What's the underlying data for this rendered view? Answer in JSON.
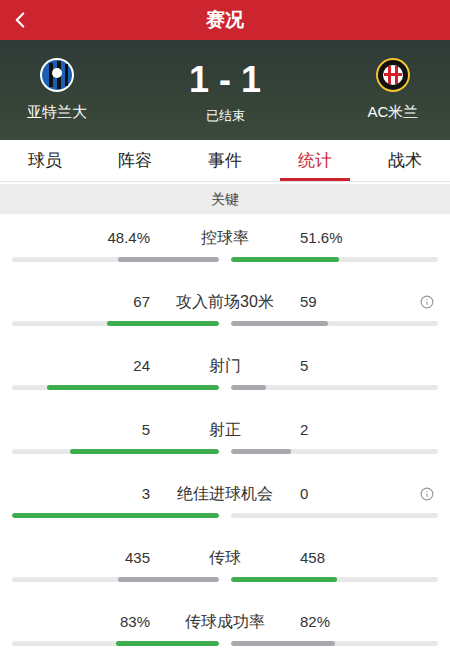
{
  "header": {
    "title": "赛况"
  },
  "match": {
    "home": {
      "name": "亚特兰大"
    },
    "away": {
      "name": "AC米兰"
    },
    "score": "1 - 1",
    "status": "已结束"
  },
  "tabs": [
    {
      "label": "球员",
      "selected": false
    },
    {
      "label": "阵容",
      "selected": false
    },
    {
      "label": "事件",
      "selected": false
    },
    {
      "label": "统计",
      "selected": true
    },
    {
      "label": "战术",
      "selected": false
    }
  ],
  "section": {
    "title": "关键"
  },
  "stats": [
    {
      "label": "控球率",
      "info": false,
      "left": {
        "value": "48.4%",
        "level": 0.49,
        "color": "#a8a8ae"
      },
      "right": {
        "value": "51.6%",
        "level": 0.52,
        "color": "#3cae4b"
      }
    },
    {
      "label": "攻入前场30米",
      "info": true,
      "left": {
        "value": "67",
        "level": 0.54,
        "color": "#3cae4b"
      },
      "right": {
        "value": "59",
        "level": 0.47,
        "color": "#a8a8ae"
      }
    },
    {
      "label": "射门",
      "info": false,
      "left": {
        "value": "24",
        "level": 0.83,
        "color": "#3cae4b"
      },
      "right": {
        "value": "5",
        "level": 0.17,
        "color": "#a8a8ae"
      }
    },
    {
      "label": "射正",
      "info": false,
      "left": {
        "value": "5",
        "level": 0.72,
        "color": "#3cae4b"
      },
      "right": {
        "value": "2",
        "level": 0.29,
        "color": "#a8a8ae"
      }
    },
    {
      "label": "绝佳进球机会",
      "info": true,
      "left": {
        "value": "3",
        "level": 1,
        "color": "#3cae4b"
      },
      "right": {
        "value": "0",
        "level": 0,
        "color": "#a8a8ae"
      }
    },
    {
      "label": "传球",
      "info": false,
      "left": {
        "value": "435",
        "level": 0.49,
        "color": "#a8a8ae"
      },
      "right": {
        "value": "458",
        "level": 0.51,
        "color": "#3cae4b"
      }
    },
    {
      "label": "传球成功率",
      "info": false,
      "left": {
        "value": "83%",
        "level": 0.5,
        "color": "#3cae4b"
      },
      "right": {
        "value": "82%",
        "level": 0.5,
        "color": "#a8a8ae"
      }
    }
  ]
}
